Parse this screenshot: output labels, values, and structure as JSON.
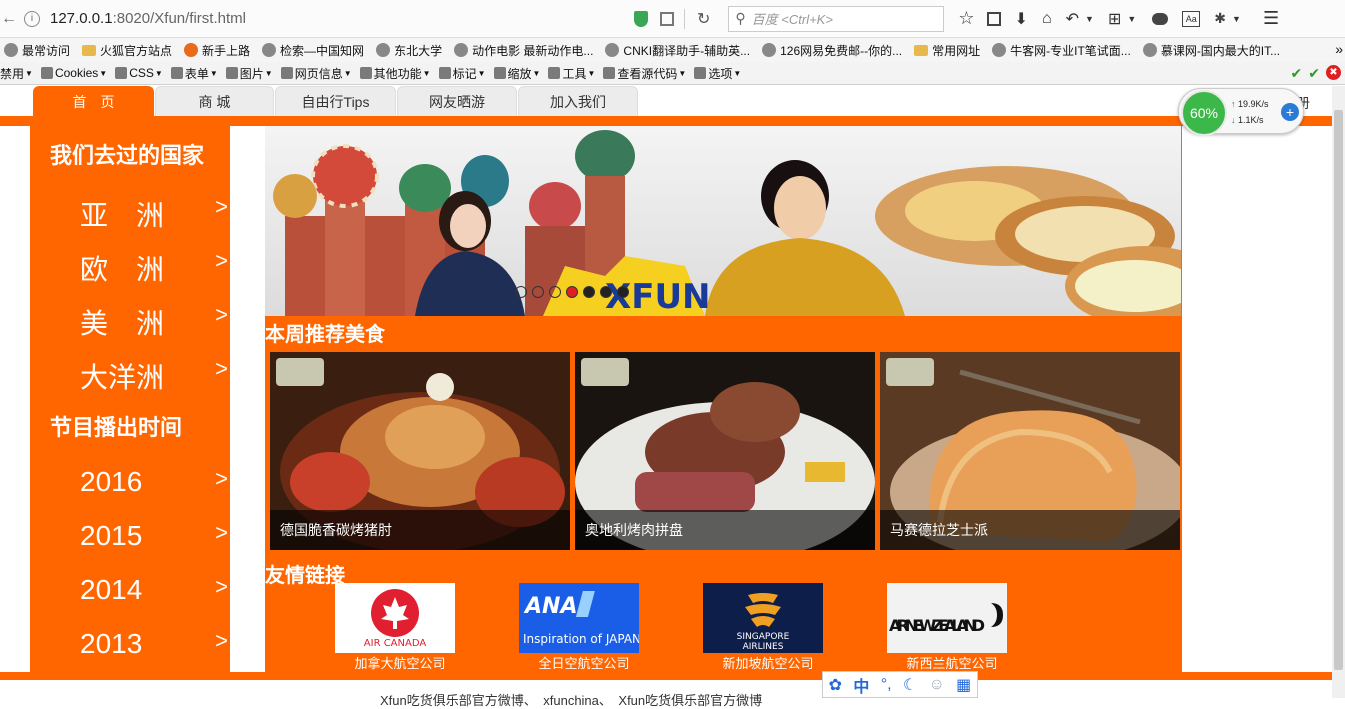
{
  "browser": {
    "url_host": "127.0.0.1",
    "url_port_path": ":8020/Xfun/first.html",
    "search_placeholder": "百度 <Ctrl+K>",
    "bookmarks": [
      {
        "label": "最常访问",
        "icon": "globe-icon"
      },
      {
        "label": "火狐官方站点",
        "icon": "folder-icon"
      },
      {
        "label": "新手上路",
        "icon": "firefox-icon"
      },
      {
        "label": "检索—中国知网",
        "icon": "globe-icon"
      },
      {
        "label": "东北大学",
        "icon": "globe-icon"
      },
      {
        "label": "动作电影 最新动作电...",
        "icon": "globe-icon"
      },
      {
        "label": "CNKI翻译助手-辅助英...",
        "icon": "globe-icon"
      },
      {
        "label": "126网易免费邮--你的...",
        "icon": "globe-icon"
      },
      {
        "label": "常用网址",
        "icon": "folder-icon"
      },
      {
        "label": "牛客网-专业IT笔试面...",
        "icon": "globe-icon"
      },
      {
        "label": "慕课网-国内最大的IT...",
        "icon": "globe-icon"
      }
    ],
    "bookmarks_more": "»",
    "toolbar": [
      "禁用",
      "Cookies",
      "CSS",
      "表单",
      "图片",
      "网页信息",
      "其他功能",
      "标记",
      "缩放",
      "工具",
      "查看源代码",
      "选项"
    ],
    "net_widget": {
      "percent": "60%",
      "up": "19.9K/s",
      "down": "1.1K/s"
    }
  },
  "nav": {
    "tabs": [
      "首　页",
      "商 城",
      "自由行Tips",
      "网友晒游",
      "加入我们"
    ],
    "right_text": "册"
  },
  "sidebar": {
    "countries_title": "我们去过的国家",
    "countries": [
      "亚　洲",
      "欧　洲",
      "美　洲",
      "大洋洲"
    ],
    "schedule_title": "节目播出时间",
    "years": [
      "2016",
      "2015",
      "2014",
      "2013"
    ],
    "arrow": ">"
  },
  "banner": {
    "dots": 7,
    "active_dot": 4,
    "logo_text": "XFUN"
  },
  "food": {
    "title": "本周推荐美食",
    "items": [
      "德国脆香碳烤猪肘",
      "奥地利烤肉拼盘",
      "马赛德拉芝士派"
    ]
  },
  "links": {
    "title": "友情链接",
    "airlines": [
      {
        "name": "加拿大航空公司",
        "logo_text": "AIR CANADA"
      },
      {
        "name": "全日空航空公司",
        "logo_text": "ANA Inspiration of JAPAN"
      },
      {
        "name": "新加坡航空公司",
        "logo_text": "SINGAPORE AIRLINES"
      },
      {
        "name": "新西兰航空公司",
        "logo_text": "AIR NEW ZEALAND"
      }
    ]
  },
  "footer": {
    "text": "Xfun吃货俱乐部官方微博、　xfunchina、　Xfun吃货俱乐部官方微博"
  },
  "ime": {
    "label": "中"
  },
  "colors": {
    "accent": "#ff6600"
  }
}
